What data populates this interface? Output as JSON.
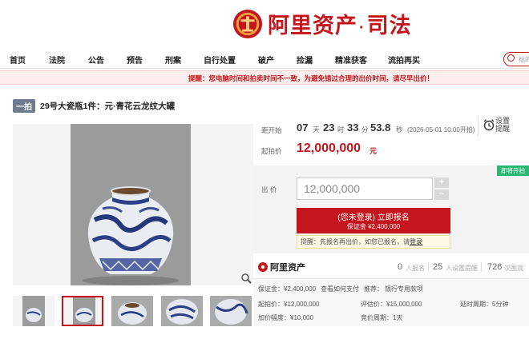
{
  "header": {
    "brand": "阿里资产",
    "brand_suffix": "司法",
    "brand_dot": "·"
  },
  "nav": {
    "items": [
      "首页",
      "法院",
      "公告",
      "预告",
      "刑案",
      "自行处置",
      "破产",
      "捡漏",
      "精准获客",
      "流拍再买"
    ],
    "search_placeholder": "标的"
  },
  "notice": "提醒：您电脑时间和拍卖时间不一致，为避免错过合理的出价时间，请尽早出价！",
  "item": {
    "tag": "一拍",
    "title": "29号大瓷瓶1件：元·青花云龙纹大罐"
  },
  "countdown": {
    "label": "距开始",
    "days": "07",
    "days_unit": "天",
    "hours": "23",
    "hours_unit": "时",
    "minutes": "33",
    "minutes_unit": "分",
    "seconds": "53.8",
    "seconds_unit": "秒",
    "start_time": "(2026-05-01 10:00开拍)",
    "setting_line1": "设置",
    "setting_line2": "提醒"
  },
  "price": {
    "start_label": "起拍价",
    "start_value": "12,000,000",
    "unit": "元"
  },
  "bid": {
    "open_badge": "即将开拍",
    "label": "出 价",
    "value": "12,000,000",
    "plus": "+",
    "minus": "−",
    "signup_line1": "(您未登录) 立即报名",
    "signup_line2": "保证金 ¥2,400,000",
    "tip_text": "提醒：先报名再出价，如您已报名，请",
    "tip_login": "登录"
  },
  "stats": {
    "brand": "阿里资产",
    "signup_count": "0",
    "signup_label": "人报名",
    "remind_count": "25",
    "remind_label": "人设置提醒",
    "view_count": "726",
    "view_label": "次围观"
  },
  "details": {
    "deposit_label": "保证金：",
    "deposit_value": "¥2,400,000",
    "deposit_link": "查看如何支付",
    "recommend_label": "推荐：",
    "recommend_link": "银行专用款项",
    "start_price_label": "起拍价：",
    "start_price_value": "¥12,000,000",
    "eval_label": "评估价：",
    "eval_value": "¥15,000,000",
    "delay_label": "延时周期：",
    "delay_value": "5分钟",
    "increment_label": "加价幅度：",
    "increment_value": "¥10,000",
    "period_label": "竞价周期：",
    "period_value": "1天"
  },
  "colors": {
    "brand_red": "#c4161c",
    "open_green": "#2bb673",
    "tag_gray": "#6e7a8f",
    "link_blue": "#2a6ebb"
  }
}
